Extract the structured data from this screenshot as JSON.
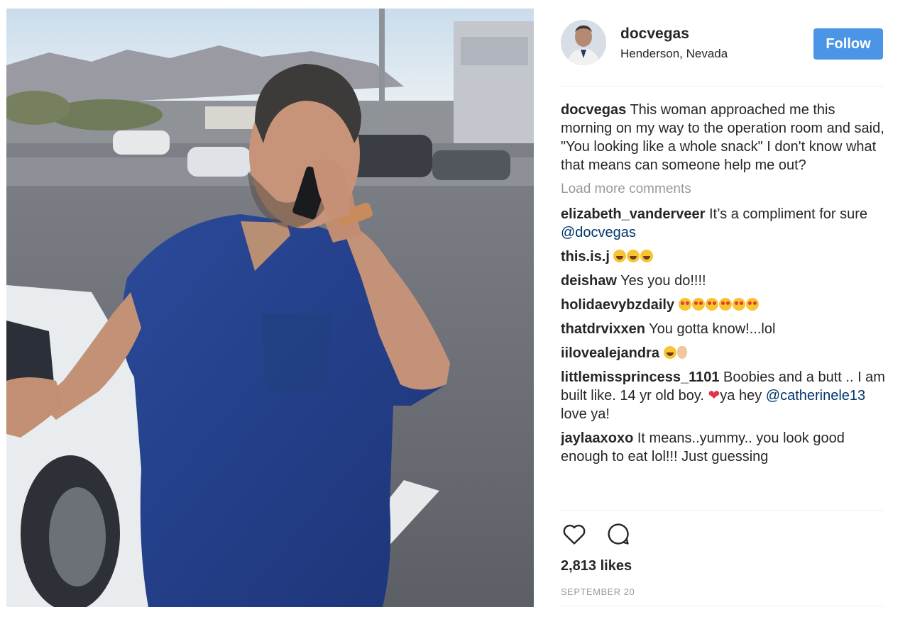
{
  "post": {
    "photo_alt": "Man in blue scrubs talking on a phone in a parking lot",
    "author": {
      "username": "docvegas",
      "location": "Henderson, Nevada",
      "follow_label": "Follow"
    },
    "caption": {
      "username": "docvegas",
      "text": "This woman approached me this morning on my way to the operation room and said, \"You looking like a whole snack\" I don't know what that means can someone help me out?"
    },
    "load_more_label": "Load more comments",
    "comments": [
      {
        "username": "elizabeth_vanderveer",
        "text": "It’s a compliment for sure",
        "mention": "@docvegas"
      },
      {
        "username": "this.is.j",
        "emoji": [
          "laugh",
          "laugh",
          "laugh"
        ]
      },
      {
        "username": "deishaw",
        "text": "Yes you do!!!!"
      },
      {
        "username": "holidaevybzdaily",
        "emoji": [
          "heart-eyes",
          "heart-eyes",
          "heart-eyes",
          "heart-eyes",
          "heart-eyes",
          "heart-eyes"
        ]
      },
      {
        "username": "thatdrvixxen",
        "text": "You gotta know!...lol"
      },
      {
        "username": "iilovealejandra",
        "emoji": [
          "laugh",
          "ok"
        ]
      },
      {
        "username": "littlemissprincess_1101",
        "text": "Boobies and a butt .. I am built like. 14 yr old boy.",
        "heart": "❤",
        "text2": "ya hey",
        "mention": "@catherinele13",
        "text3": "love ya!"
      },
      {
        "username": "jaylaaxoxo",
        "text": "It means..yummy.. you look good enough to eat lol!!!  Just guessing"
      }
    ],
    "likes": "2,813 likes",
    "date": "SEPTEMBER 20",
    "icons": {
      "like": "heart-outline-icon",
      "comment": "comment-bubble-icon"
    },
    "colors": {
      "follow_button": "#4a95e6",
      "mention": "#003569",
      "muted": "#999999"
    }
  }
}
